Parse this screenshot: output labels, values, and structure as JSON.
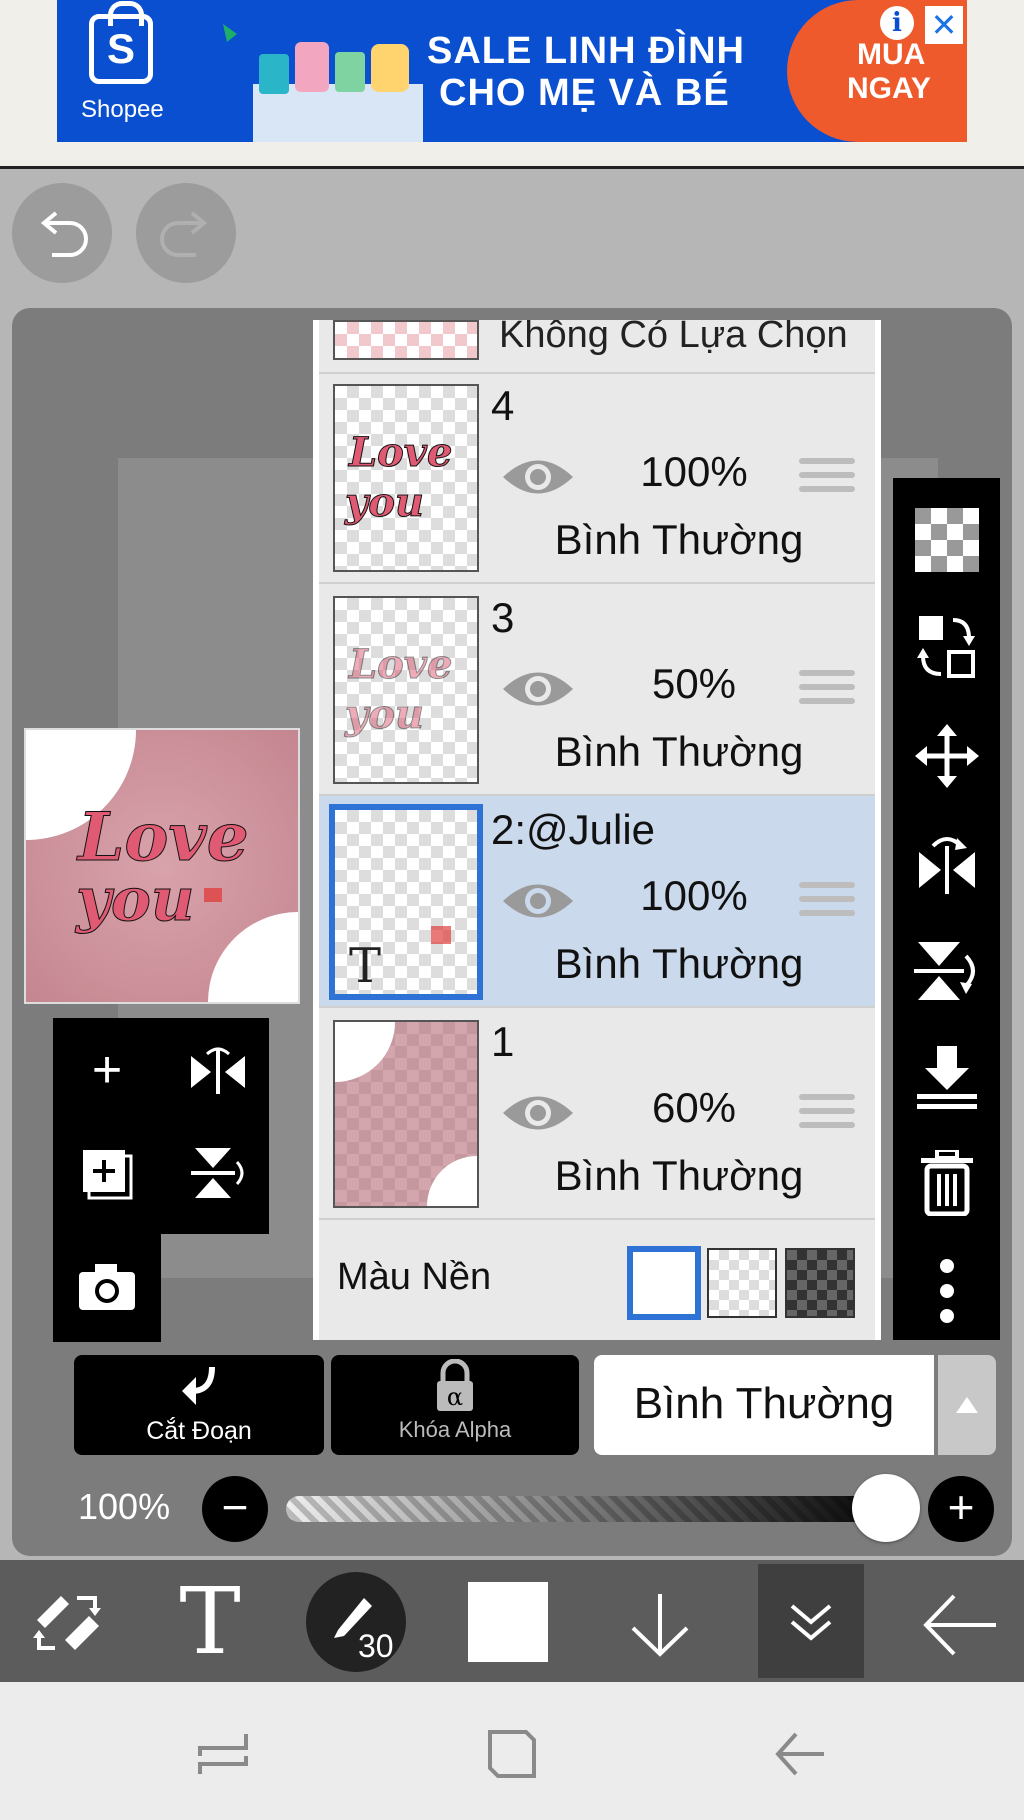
{
  "ad": {
    "brand": "Shopee",
    "brand_letter": "S",
    "headline_line1": "SALE LINH ĐÌNH",
    "headline_line2": "CHO MẸ VÀ BÉ",
    "cta_line1": "MUA",
    "cta_line2": "NGAY",
    "info_icon": "i",
    "close_icon": "✕",
    "colors": {
      "background": "#0a4fd0",
      "cta": "#ef5a2c"
    }
  },
  "history": {
    "undo_icon": "undo-icon",
    "redo_icon": "redo-icon"
  },
  "preview": {
    "text_line1": "Love",
    "text_line2": "you"
  },
  "layers_panel": {
    "no_selection_label": "Không Có Lựa Chọn",
    "layers": [
      {
        "name": "4",
        "opacity": "100%",
        "blend": "Bình Thường",
        "selected": false
      },
      {
        "name": "3",
        "opacity": "50%",
        "blend": "Bình Thường",
        "selected": false
      },
      {
        "name": "2:@Julie",
        "opacity": "100%",
        "blend": "Bình Thường",
        "selected": true,
        "thumb_text": "T"
      },
      {
        "name": "1",
        "opacity": "60%",
        "blend": "Bình Thường",
        "selected": false
      }
    ],
    "background_label": "Màu Nền",
    "background_options": [
      "white",
      "transparent",
      "dark"
    ],
    "background_selected": "white"
  },
  "left_tools": [
    "add-layer-icon",
    "flip-horizontal-icon",
    "add-image-layer-icon",
    "flip-vertical-icon",
    "camera-icon"
  ],
  "right_tools": [
    "transparency-icon",
    "swap-layer-icon",
    "move-icon",
    "flip-h-icon",
    "flip-v-icon",
    "merge-down-icon",
    "trash-icon",
    "more-icon"
  ],
  "actions": {
    "clip_label": "Cắt Đoạn",
    "alpha_lock_label": "Khóa Alpha",
    "alpha_symbol": "α",
    "blend_mode": "Bình Thường"
  },
  "opacity": {
    "label": "100%",
    "value": 1.0,
    "minus": "−",
    "plus": "+"
  },
  "bottom_toolbar": {
    "text_tool": "T",
    "brush_size": "30",
    "active_tool": "layers-down"
  },
  "colors": {
    "accent": "#2f72d6",
    "selected_row": "#cbd9ec"
  }
}
